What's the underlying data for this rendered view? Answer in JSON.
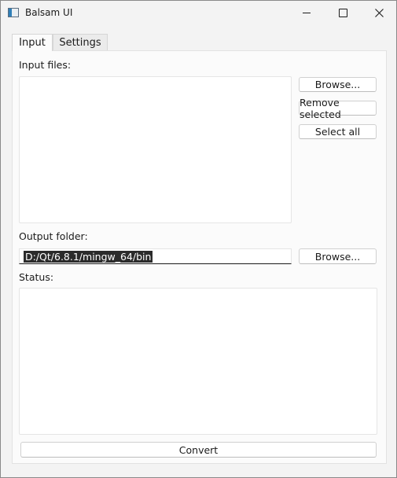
{
  "window": {
    "title": "Balsam UI"
  },
  "tabs": [
    {
      "label": "Input"
    },
    {
      "label": "Settings"
    }
  ],
  "input": {
    "files_label": "Input files:",
    "browse_label": "Browse...",
    "remove_selected_label": "Remove selected",
    "select_all_label": "Select all",
    "files": []
  },
  "output": {
    "folder_label": "Output folder:",
    "folder_value": "D:/Qt/6.8.1/mingw_64/bin",
    "browse_label": "Browse..."
  },
  "status": {
    "label": "Status:",
    "text": ""
  },
  "convert_label": "Convert",
  "icons": {
    "app": "window-app-icon",
    "minimize": "minimize-icon",
    "maximize": "maximize-icon",
    "close": "close-icon"
  }
}
